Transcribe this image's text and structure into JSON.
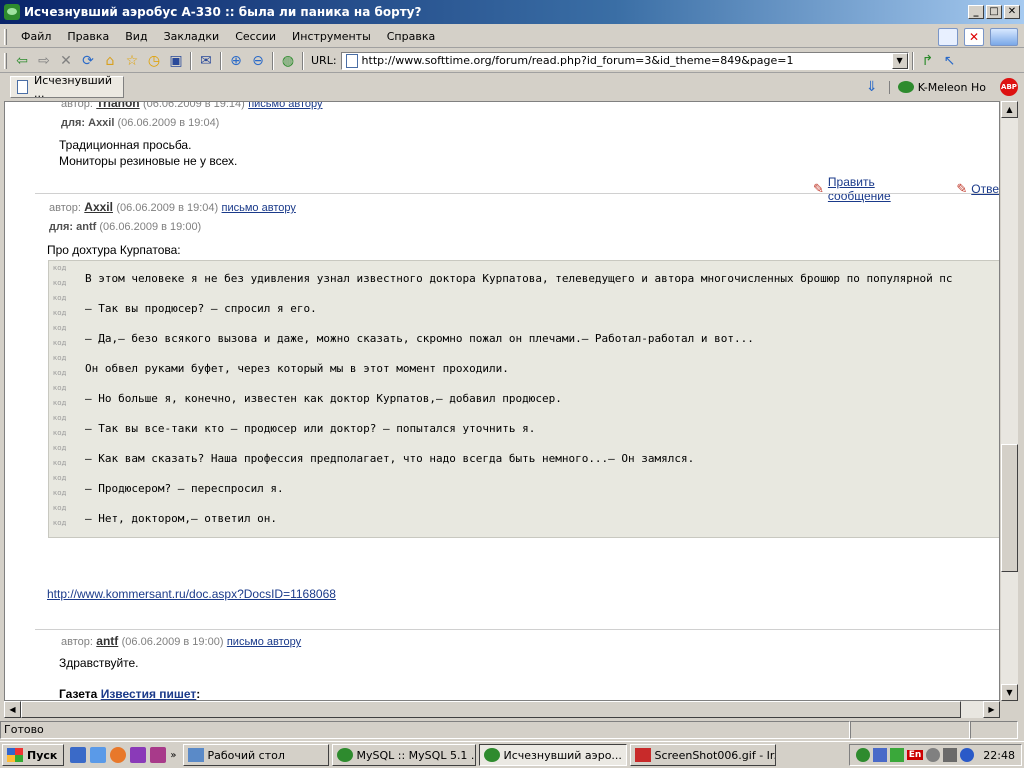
{
  "window": {
    "title": "Исчезнувший аэробус А-330 :: была ли паника на борту?",
    "minimize": "_",
    "maximize": "□",
    "close": "✕"
  },
  "menu": [
    "Файл",
    "Правка",
    "Вид",
    "Закладки",
    "Сессии",
    "Инструменты",
    "Справка"
  ],
  "toolbar": {
    "url_label": "URL:",
    "url": "http://www.softtime.org/forum/read.php?id_forum=3&id_theme=849&page=1"
  },
  "tabs": {
    "active_tab": "Исчезнувший ...",
    "kmeleon_label": "K-Meleon Ho",
    "abp_label": "ABP"
  },
  "posts": {
    "p1": {
      "author_prefix": "автор:",
      "author": "Trianon",
      "date": "(06.06.2009 в 19:14)",
      "mail": "письмо автору",
      "to_prefix": "для:",
      "to": "Axxil",
      "to_date": "(06.06.2009 в 19:04)",
      "line1": "Традиционная просьба.",
      "line2": "Мониторы резиновые не у всех.",
      "edit": "Править сообщение",
      "reply": "Отве"
    },
    "p2": {
      "author_prefix": "автор:",
      "author": "Axxil",
      "date": "(06.06.2009 в 19:04)",
      "mail": "письмо автору",
      "to_prefix": "для:",
      "to": "antf",
      "to_date": "(06.06.2009 в 19:00)",
      "intro": "Про дохтура Курпатова:",
      "code_label": "код",
      "code_lines": [
        "В этом человеке я не без удивления узнал известного доктора Курпатова, телеведущего и автора многочисленных брошюр по популярной пс",
        "— Так вы продюсер? — спросил я его.",
        "— Да,— безо всякого вызова и даже, можно сказать, скромно пожал он плечами.— Работал-работал и вот...",
        "Он обвел руками буфет, через который мы в этот момент проходили.",
        "— Но больше я, конечно, известен как доктор Курпатов,— добавил продюсер.",
        "— Так вы все-таки кто — продюсер или доктор? — попытался уточнить я.",
        "— Как вам сказать? Наша профессия предполагает, что надо всегда быть немного...— Он замялся.",
        "— Продюсером? — переспросил я.",
        "— Нет, доктором,— ответил он."
      ],
      "link": "http://www.kommersant.ru/doc.aspx?DocsID=1168068"
    },
    "p3": {
      "author_prefix": "автор:",
      "author": "antf",
      "date": "(06.06.2009 в 19:00)",
      "mail": "письмо автору",
      "greeting": "Здравствуйте.",
      "gazette_prefix": "Газета",
      "gazette_link": "Известия пишет",
      "gazette_suffix": ":"
    }
  },
  "status": {
    "text": "Готово"
  },
  "taskbar": {
    "start": "Пуск",
    "tasks": [
      "Рабочий стол",
      "MySQL :: MySQL 5.1 ...",
      "Исчезнувший аэро...",
      "ScreenShot006.gif - Ir..."
    ],
    "lang": "En",
    "clock": "22:48"
  }
}
